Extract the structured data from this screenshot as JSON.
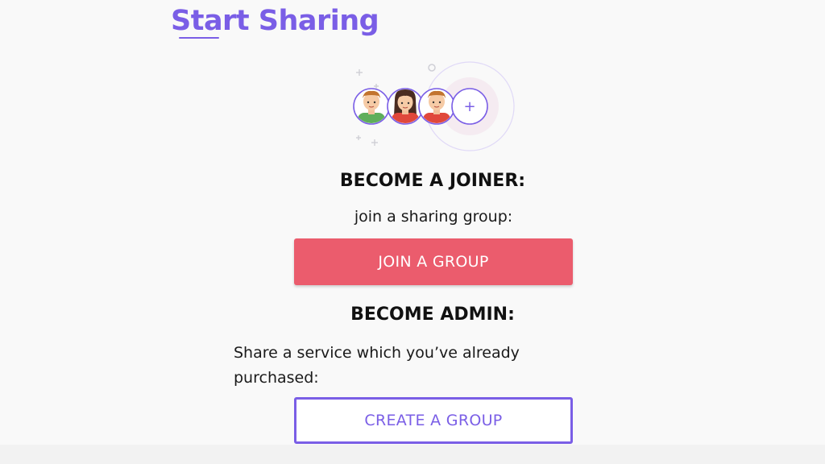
{
  "header": {
    "title": "Start Sharing"
  },
  "illustration": {
    "plus_symbol": "+",
    "avatars": [
      "boy-avatar-green",
      "girl-avatar-red",
      "boy-avatar-red"
    ]
  },
  "joiner": {
    "heading": "BECOME A JOINER:",
    "subtitle": "join a sharing group:",
    "button_label": "JOIN A GROUP"
  },
  "admin": {
    "heading": "BECOME ADMIN:",
    "subtitle": "Share a service which you’ve already purchased:",
    "button_label": "CREATE A GROUP"
  },
  "colors": {
    "accent": "#7a5ee6",
    "join_button": "#eb5c6d",
    "background": "#f9f9f9"
  }
}
